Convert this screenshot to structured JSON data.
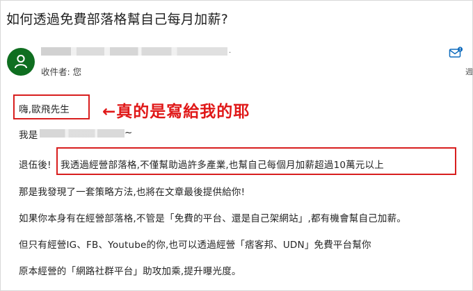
{
  "email": {
    "subject": "如何透過免費部落格幫自己每月加薪?",
    "sender_suffix": "·",
    "recipient": "收件者: 您",
    "side_cut": "週"
  },
  "body": {
    "greeting": "嗨,歐飛先生",
    "annotation": "←真的是寫給我的耶",
    "intro_prefix": "我是",
    "intro_suffix": "~",
    "line1_prefix": "退伍後!",
    "line1_main": "我透過經營部落格,不僅幫助過許多產業,也幫自己每個月加薪超過10萬元以上",
    "line2": "那是我發現了一套策略方法,也將在文章最後提供給你!",
    "line3": "如果你本身有在經營部落格,不管是「免費的平台、還是自己架網站」,都有機會幫自己加薪。",
    "line4": "但只有經營IG、FB、Youtube的你,也可以透過經營「痞客邦、UDN」免費平台幫你",
    "line5": "原本經營的「網路社群平台」助攻加乘,提升曝光度。"
  },
  "colors": {
    "avatar": "#0f6e20",
    "highlight": "#d81e1e",
    "annotation": "#e01818",
    "mail_icon": "#0f6cbd"
  },
  "icons": {
    "avatar": "person-icon",
    "mail": "mail-notification-icon"
  }
}
